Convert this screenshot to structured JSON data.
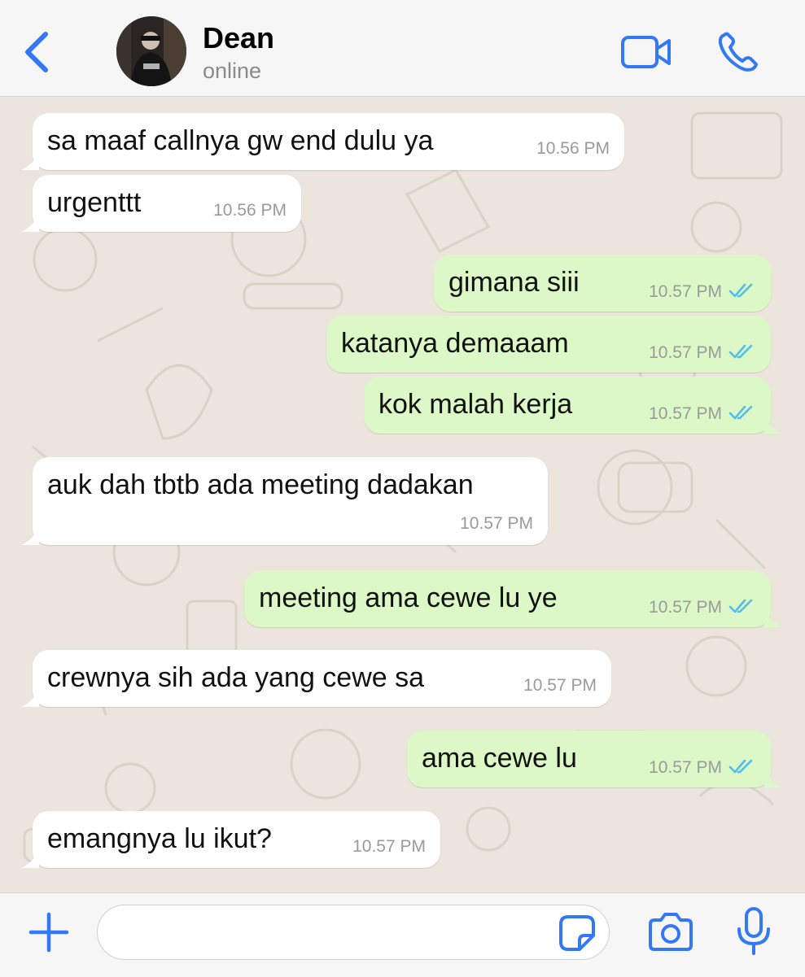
{
  "header": {
    "contact_name": "Dean",
    "status": "online",
    "back_icon": "chevron-left-icon",
    "video_icon": "video-camera-icon",
    "call_icon": "phone-icon"
  },
  "messages": [
    {
      "direction": "in",
      "text": "sa maaf callnya gw end dulu ya",
      "time": "10.56 PM"
    },
    {
      "direction": "in",
      "text": "urgenttt",
      "time": "10.56 PM"
    },
    {
      "direction": "out",
      "text": "gimana siii",
      "time": "10.57 PM",
      "status": "read"
    },
    {
      "direction": "out",
      "text": "katanya demaaam",
      "time": "10.57 PM",
      "status": "read"
    },
    {
      "direction": "out",
      "text": "kok malah kerja",
      "time": "10.57 PM",
      "status": "read"
    },
    {
      "direction": "in",
      "text": "auk dah tbtb ada meeting dadakan",
      "time": "10.57 PM"
    },
    {
      "direction": "out",
      "text": "meeting ama cewe lu ye",
      "time": "10.57 PM",
      "status": "read"
    },
    {
      "direction": "in",
      "text": "crewnya sih ada yang cewe sa",
      "time": "10.57 PM"
    },
    {
      "direction": "out",
      "text": "ama cewe lu",
      "time": "10.57 PM",
      "status": "read"
    },
    {
      "direction": "in",
      "text": "emangnya lu ikut?",
      "time": "10.57 PM"
    }
  ],
  "input_bar": {
    "message_value": "",
    "plus_icon": "plus-icon",
    "sticker_icon": "sticker-icon",
    "camera_icon": "camera-icon",
    "mic_icon": "microphone-icon"
  },
  "colors": {
    "accent": "#3478f6",
    "incoming_bubble": "#ffffff",
    "outgoing_bubble": "#dcf8c6",
    "read_ticks": "#53bdeb",
    "chat_background": "#ece5dd"
  }
}
